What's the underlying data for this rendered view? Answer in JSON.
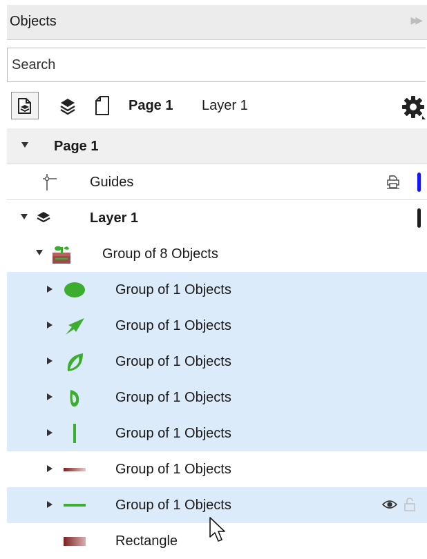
{
  "panel": {
    "title": "Objects",
    "search_placeholder": "Search"
  },
  "toolbar": {
    "page_label": "Page 1",
    "layer_label": "Layer 1"
  },
  "tree": {
    "page": "Page 1",
    "guides": "Guides",
    "layer": "Layer 1",
    "group8": "Group of 8 Objects",
    "children": [
      "Group of 1 Objects",
      "Group of 1 Objects",
      "Group of 1 Objects",
      "Group of 1 Objects",
      "Group of 1 Objects",
      "Group of 1 Objects",
      "Group of 1 Objects"
    ],
    "rectangle": "Rectangle"
  },
  "colors": {
    "selection": "#dcebfa",
    "guides_layer": "#1414ff",
    "layer_1": "#1e1e1e",
    "leaf_green": "#3cad2f"
  },
  "icons": {
    "toolbar": [
      "layer-settings-icon",
      "layers-icon",
      "page-icon",
      "gear-icon"
    ],
    "rows": [
      "guides-icon",
      "layer-icon",
      "group-icon",
      "ellipse-icon",
      "arrow-leaf-icon",
      "leaf-icon",
      "drop-icon",
      "stem-icon",
      "gradient-bar-icon",
      "line-icon",
      "rectangle-icon",
      "printer-icon",
      "eye-icon",
      "lock-icon",
      "cursor-icon"
    ]
  }
}
